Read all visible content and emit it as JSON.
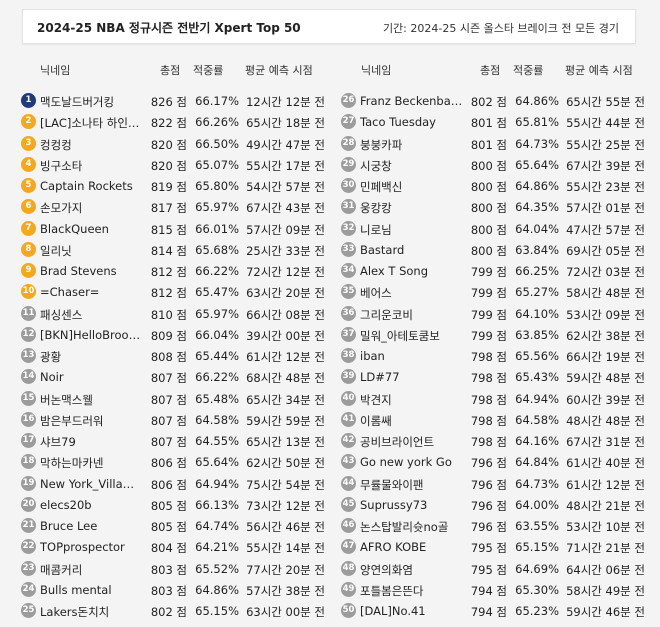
{
  "header": {
    "title": "2024-25 NBA 정규시즌 전반기 Xpert Top 50",
    "period": "기간: 2024-25 시즌 올스타 브레이크 전 모든 경기"
  },
  "columns": {
    "nickname": "닉네임",
    "score": "총점",
    "rate": "적중률",
    "avg_time": "평균 예측 시점"
  },
  "rankings": [
    {
      "rank": "1",
      "nick": "맥도날드버거킹",
      "score": "826 점",
      "rate": "66.17%",
      "time": "12시간 12분 전"
    },
    {
      "rank": "2",
      "nick": "[LAC]소나타 하인…",
      "score": "822 점",
      "rate": "66.26%",
      "time": "65시간 18분 전"
    },
    {
      "rank": "3",
      "nick": "컹컹컹",
      "score": "820 점",
      "rate": "66.50%",
      "time": "49시간 47분 전"
    },
    {
      "rank": "4",
      "nick": "빙구소타",
      "score": "820 점",
      "rate": "65.07%",
      "time": "55시간 17분 전"
    },
    {
      "rank": "5",
      "nick": "Captain Rockets",
      "score": "819 점",
      "rate": "65.80%",
      "time": "54시간 57분 전"
    },
    {
      "rank": "6",
      "nick": "손모가지",
      "score": "817 점",
      "rate": "65.97%",
      "time": "67시간 43분 전"
    },
    {
      "rank": "7",
      "nick": "BlackQueen",
      "score": "815 점",
      "rate": "66.01%",
      "time": "57시간 09분 전"
    },
    {
      "rank": "8",
      "nick": "일리닛",
      "score": "814 점",
      "rate": "65.68%",
      "time": "25시간 33분 전"
    },
    {
      "rank": "9",
      "nick": "Brad Stevens",
      "score": "812 점",
      "rate": "66.22%",
      "time": "72시간 12분 전"
    },
    {
      "rank": "10",
      "nick": "=Chaser=",
      "score": "812 점",
      "rate": "65.47%",
      "time": "63시간 20분 전"
    },
    {
      "rank": "11",
      "nick": "패싱센스",
      "score": "810 점",
      "rate": "65.97%",
      "time": "66시간 08분 전"
    },
    {
      "rank": "12",
      "nick": "[BKN]HelloBroo…",
      "score": "809 점",
      "rate": "66.04%",
      "time": "39시간 00분 전"
    },
    {
      "rank": "13",
      "nick": "광황",
      "score": "808 점",
      "rate": "65.44%",
      "time": "61시간 12분 전"
    },
    {
      "rank": "14",
      "nick": "Noir",
      "score": "807 점",
      "rate": "66.22%",
      "time": "68시간 48분 전"
    },
    {
      "rank": "15",
      "nick": "버논맥스웰",
      "score": "807 점",
      "rate": "65.48%",
      "time": "65시간 34분 전"
    },
    {
      "rank": "16",
      "nick": "밤은부드러워",
      "score": "807 점",
      "rate": "64.58%",
      "time": "59시간 59분 전"
    },
    {
      "rank": "17",
      "nick": "샤브79",
      "score": "807 점",
      "rate": "64.55%",
      "time": "65시간 13분 전"
    },
    {
      "rank": "18",
      "nick": "막하는마카넨",
      "score": "806 점",
      "rate": "65.64%",
      "time": "62시간 50분 전"
    },
    {
      "rank": "19",
      "nick": "New York_Villa…",
      "score": "806 점",
      "rate": "64.94%",
      "time": "75시간 54분 전"
    },
    {
      "rank": "20",
      "nick": "elecs20b",
      "score": "805 점",
      "rate": "66.13%",
      "time": "73시간 12분 전"
    },
    {
      "rank": "21",
      "nick": "Bruce Lee",
      "score": "805 점",
      "rate": "64.74%",
      "time": "56시간 46분 전"
    },
    {
      "rank": "22",
      "nick": "TOPprospector",
      "score": "804 점",
      "rate": "64.21%",
      "time": "55시간 14분 전"
    },
    {
      "rank": "23",
      "nick": "매콤커리",
      "score": "803 점",
      "rate": "65.52%",
      "time": "77시간 20분 전"
    },
    {
      "rank": "24",
      "nick": "Bulls mental",
      "score": "803 점",
      "rate": "64.86%",
      "time": "57시간 38분 전"
    },
    {
      "rank": "25",
      "nick": "Lakers돈치치",
      "score": "802 점",
      "rate": "65.15%",
      "time": "63시간 00분 전"
    },
    {
      "rank": "26",
      "nick": "Franz Beckenba…",
      "score": "802 점",
      "rate": "64.86%",
      "time": "65시간 55분 전"
    },
    {
      "rank": "27",
      "nick": "Taco Tuesday",
      "score": "801 점",
      "rate": "65.81%",
      "time": "55시간 44분 전"
    },
    {
      "rank": "28",
      "nick": "붕붕카파",
      "score": "801 점",
      "rate": "64.73%",
      "time": "55시간 25분 전"
    },
    {
      "rank": "29",
      "nick": "시궁창",
      "score": "800 점",
      "rate": "65.64%",
      "time": "67시간 39분 전"
    },
    {
      "rank": "30",
      "nick": "민페백신",
      "score": "800 점",
      "rate": "64.86%",
      "time": "55시간 23분 전"
    },
    {
      "rank": "31",
      "nick": "웅캉캉",
      "score": "800 점",
      "rate": "64.35%",
      "time": "57시간 01분 전"
    },
    {
      "rank": "32",
      "nick": "니로님",
      "score": "800 점",
      "rate": "64.04%",
      "time": "47시간 57분 전"
    },
    {
      "rank": "33",
      "nick": "Bastard",
      "score": "800 점",
      "rate": "63.84%",
      "time": "69시간 05분 전"
    },
    {
      "rank": "34",
      "nick": "Alex T Song",
      "score": "799 점",
      "rate": "66.25%",
      "time": "72시간 03분 전"
    },
    {
      "rank": "35",
      "nick": "베어스",
      "score": "799 점",
      "rate": "65.27%",
      "time": "58시간 48분 전"
    },
    {
      "rank": "36",
      "nick": "그리운코비",
      "score": "799 점",
      "rate": "64.10%",
      "time": "53시간 09분 전"
    },
    {
      "rank": "37",
      "nick": "밀워_아테토쿰보",
      "score": "799 점",
      "rate": "63.85%",
      "time": "62시간 38분 전"
    },
    {
      "rank": "38",
      "nick": "iban",
      "score": "798 점",
      "rate": "65.56%",
      "time": "66시간 19분 전"
    },
    {
      "rank": "39",
      "nick": "LD#77",
      "score": "798 점",
      "rate": "65.43%",
      "time": "59시간 48분 전"
    },
    {
      "rank": "40",
      "nick": "박견지",
      "score": "798 점",
      "rate": "64.94%",
      "time": "60시간 39분 전"
    },
    {
      "rank": "41",
      "nick": "이롬쌔",
      "score": "798 점",
      "rate": "64.58%",
      "time": "48시간 48분 전"
    },
    {
      "rank": "42",
      "nick": "공비브라이언트",
      "score": "798 점",
      "rate": "64.16%",
      "time": "67시간 31분 전"
    },
    {
      "rank": "43",
      "nick": "Go new york Go",
      "score": "796 점",
      "rate": "64.84%",
      "time": "61시간 40분 전"
    },
    {
      "rank": "44",
      "nick": "무률물와이팬",
      "score": "796 점",
      "rate": "64.73%",
      "time": "61시간 12분 전"
    },
    {
      "rank": "45",
      "nick": "Suprussy73",
      "score": "796 점",
      "rate": "64.00%",
      "time": "48시간 21분 전"
    },
    {
      "rank": "46",
      "nick": "논스탑발리슛no골",
      "score": "796 점",
      "rate": "63.55%",
      "time": "53시간 10분 전"
    },
    {
      "rank": "47",
      "nick": "AFRO KOBE",
      "score": "795 점",
      "rate": "65.15%",
      "time": "71시간 21분 전"
    },
    {
      "rank": "48",
      "nick": "양연의화염",
      "score": "795 점",
      "rate": "64.69%",
      "time": "64시간 06분 전"
    },
    {
      "rank": "49",
      "nick": "포틀봄은뜬다",
      "score": "794 점",
      "rate": "65.30%",
      "time": "58시간 49분 전"
    },
    {
      "rank": "50",
      "nick": "[DAL]No.41",
      "score": "794 점",
      "rate": "65.23%",
      "time": "59시간 46분 전"
    }
  ]
}
